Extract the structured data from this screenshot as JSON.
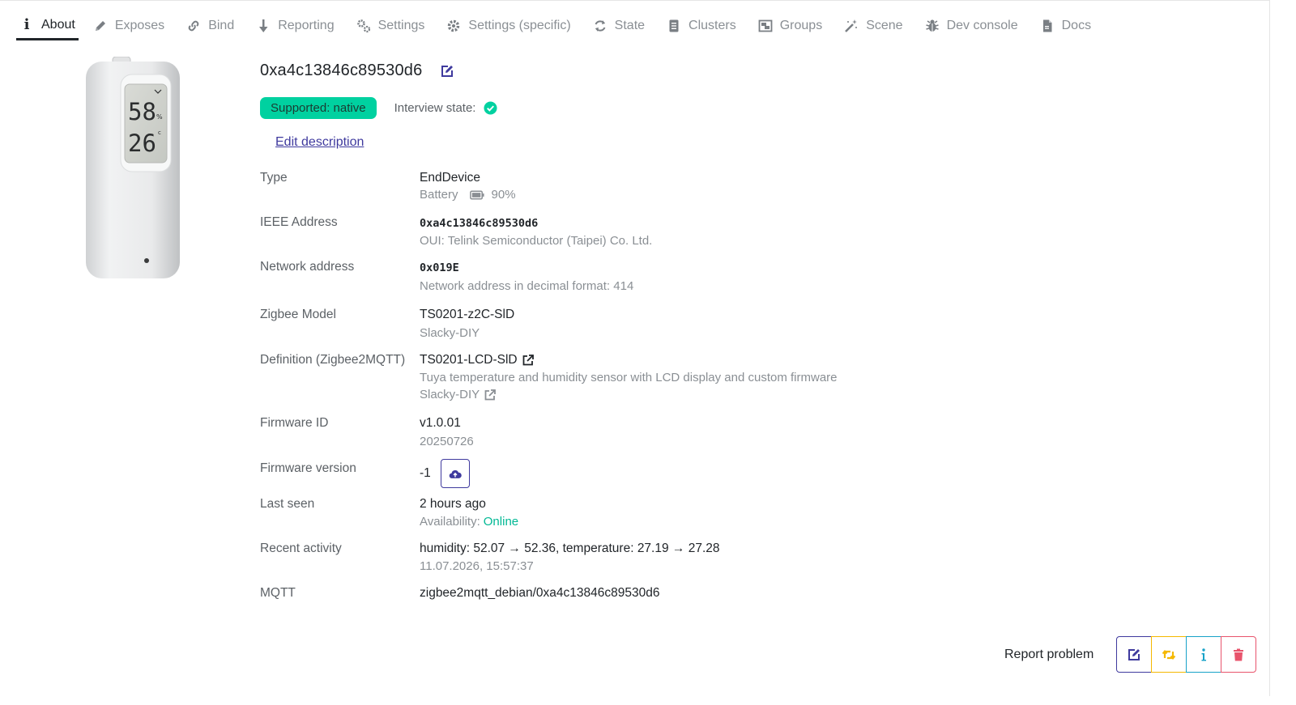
{
  "tabs": [
    {
      "label": "About",
      "icon": "info-icon"
    },
    {
      "label": "Exposes",
      "icon": "pencil-icon"
    },
    {
      "label": "Bind",
      "icon": "link-icon"
    },
    {
      "label": "Reporting",
      "icon": "arrow-down-icon"
    },
    {
      "label": "Settings",
      "icon": "gears-icon"
    },
    {
      "label": "Settings (specific)",
      "icon": "gear-icon"
    },
    {
      "label": "State",
      "icon": "refresh-icon"
    },
    {
      "label": "Clusters",
      "icon": "list-icon"
    },
    {
      "label": "Groups",
      "icon": "object-group-icon"
    },
    {
      "label": "Scene",
      "icon": "magic-wand-icon"
    },
    {
      "label": "Dev console",
      "icon": "bug-icon"
    },
    {
      "label": "Docs",
      "icon": "file-icon"
    }
  ],
  "device": {
    "display_humidity": "58",
    "display_humidity_unit": "%",
    "display_temp": "26",
    "display_temp_unit": "c"
  },
  "header": {
    "title": "0xa4c13846c89530d6",
    "support_badge": "Supported: native",
    "interview_label": "Interview state:",
    "edit_description": "Edit description"
  },
  "details": {
    "type": {
      "label": "Type",
      "value": "EndDevice",
      "sub": "Battery",
      "battery": "90%"
    },
    "ieee": {
      "label": "IEEE Address",
      "value": "0xa4c13846c89530d6",
      "sub": "OUI: Telink Semiconductor (Taipei) Co. Ltd."
    },
    "network": {
      "label": "Network address",
      "value": "0x019E",
      "sub": "Network address in decimal format: 414"
    },
    "model": {
      "label": "Zigbee Model",
      "value": "TS0201-z2C-SlD",
      "sub": "Slacky-DIY"
    },
    "definition": {
      "label": "Definition (Zigbee2MQTT)",
      "value": "TS0201-LCD-SlD",
      "sub": "Tuya temperature and humidity sensor with LCD display and custom firmware",
      "vendor": "Slacky-DIY"
    },
    "firmware_id": {
      "label": "Firmware ID",
      "value": "v1.0.01",
      "sub": "20250726"
    },
    "firmware_version": {
      "label": "Firmware version",
      "value": "-1"
    },
    "last_seen": {
      "label": "Last seen",
      "value": "2 hours ago",
      "sub": "Availability:",
      "availability": "Online"
    },
    "recent": {
      "label": "Recent activity",
      "value": "humidity: 52.07 → 52.36, temperature: 27.19 → 27.28",
      "sub": "11.07.2026, 15:57:37"
    },
    "mqtt": {
      "label": "MQTT",
      "value": "zigbee2mqtt_debian/0xa4c13846c89530d6"
    }
  },
  "footer": {
    "report_problem": "Report problem"
  },
  "colors": {
    "accent": "#3f3a9e",
    "success": "#00d1a0",
    "warning": "#f5b800",
    "info": "#17a2c8",
    "danger": "#e8546c"
  }
}
